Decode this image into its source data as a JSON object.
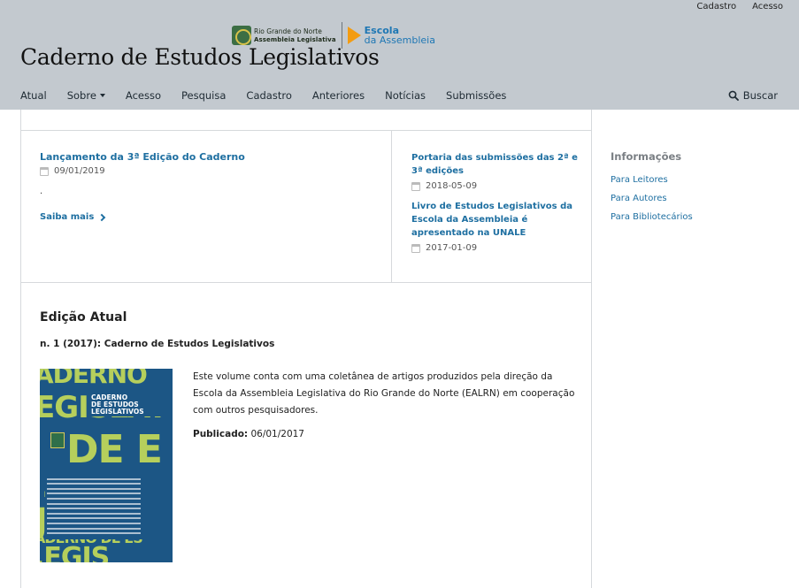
{
  "header": {
    "user_nav": [
      "Cadastro",
      "Acesso"
    ],
    "logo_left_line1": "Rio Grande do Norte",
    "logo_left_line2": "Assembleia Legislativa",
    "logo_right_line1": "Escola",
    "logo_right_line2": "da Assembleia",
    "site_title": "Caderno de Estudos Legislativos",
    "nav": [
      "Atual",
      "Sobre",
      "Acesso",
      "Pesquisa",
      "Cadastro",
      "Anteriores",
      "Notícias",
      "Submissões"
    ],
    "search_label": "Buscar"
  },
  "news": {
    "main": {
      "title": "Lançamento da 3ª Edição do Caderno",
      "date": "09/01/2019",
      "body": ".",
      "more": "Saiba mais"
    },
    "side": [
      {
        "title": "Portaria das submissões das 2ª e 3ª edições",
        "date": "2018-05-09"
      },
      {
        "title": "Livro de Estudos Legislativos da Escola da Assembleia é apresentado na UNALE",
        "date": "2017-01-09"
      }
    ]
  },
  "issue": {
    "heading": "Edição Atual",
    "id": "n. 1 (2017): Caderno de Estudos Legislativos",
    "cover": {
      "title_line1": "CADERNO",
      "title_line2": "DE ESTUDOS",
      "title_line3": "LEGISLATIVOS"
    },
    "description": "Este volume conta com uma coletânea de artigos produzidos pela direção da Escola da Assembleia Legislativa do Rio Grande do Norte (EALRN) em cooperação com outros pesquisadores.",
    "published_label": "Publicado:",
    "published_date": "06/01/2017"
  },
  "sidebar": {
    "heading": "Informações",
    "links": [
      "Para Leitores",
      "Para Autores",
      "Para Bibliotecários"
    ]
  },
  "colors": {
    "header_bg": "#c3c9cf",
    "link": "#1e6fa1",
    "cover_bg": "#1c5685",
    "cover_accent": "#b6cf5c"
  }
}
